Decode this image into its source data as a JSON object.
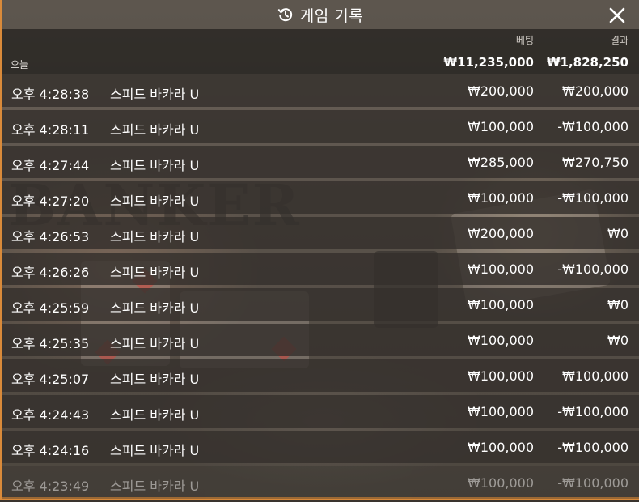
{
  "title": {
    "text": "게임 기록",
    "icon": "history-icon"
  },
  "close_icon": "close-icon",
  "columns": {
    "bet_label": "베팅",
    "result_label": "결과"
  },
  "summary": {
    "period_label": "오늘",
    "total_bet": "₩11,235,000",
    "total_result": "₩1,828,250"
  },
  "rows": [
    {
      "time": "오후 4:28:38",
      "game": "스피드 바카라 U",
      "bet": "₩200,000",
      "result": "₩200,000"
    },
    {
      "time": "오후 4:28:11",
      "game": "스피드 바카라 U",
      "bet": "₩100,000",
      "result": "-₩100,000"
    },
    {
      "time": "오후 4:27:44",
      "game": "스피드 바카라 U",
      "bet": "₩285,000",
      "result": "₩270,750"
    },
    {
      "time": "오후 4:27:20",
      "game": "스피드 바카라 U",
      "bet": "₩100,000",
      "result": "-₩100,000"
    },
    {
      "time": "오후 4:26:53",
      "game": "스피드 바카라 U",
      "bet": "₩200,000",
      "result": "₩0"
    },
    {
      "time": "오후 4:26:26",
      "game": "스피드 바카라 U",
      "bet": "₩100,000",
      "result": "-₩100,000"
    },
    {
      "time": "오후 4:25:59",
      "game": "스피드 바카라 U",
      "bet": "₩100,000",
      "result": "₩0"
    },
    {
      "time": "오후 4:25:35",
      "game": "스피드 바카라 U",
      "bet": "₩100,000",
      "result": "₩0"
    },
    {
      "time": "오후 4:25:07",
      "game": "스피드 바카라 U",
      "bet": "₩100,000",
      "result": "₩100,000"
    },
    {
      "time": "오후 4:24:43",
      "game": "스피드 바카라 U",
      "bet": "₩100,000",
      "result": "-₩100,000"
    },
    {
      "time": "오후 4:24:16",
      "game": "스피드 바카라 U",
      "bet": "₩100,000",
      "result": "-₩100,000"
    },
    {
      "time": "오후 4:23:49",
      "game": "스피드 바카라 U",
      "bet": "₩100,000",
      "result": "-₩100,000"
    }
  ],
  "colors": {
    "accent_trim": "#d98a3a",
    "row_background": "#34302c",
    "header_background": "#1c1a18"
  }
}
